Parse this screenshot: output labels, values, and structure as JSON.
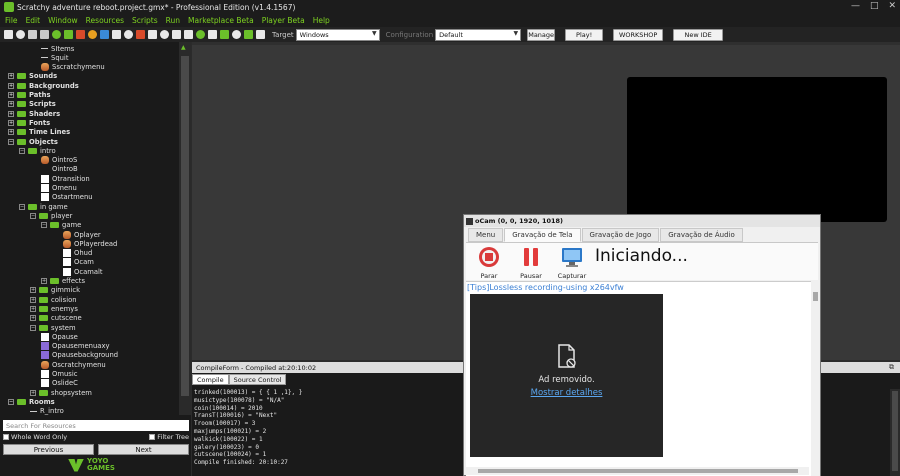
{
  "window": {
    "title": "Scratchy adventure reboot.project.gmx* - Professional Edition (v1.4.1567)",
    "controls": [
      "—",
      "□",
      "✕"
    ]
  },
  "menu": [
    "File",
    "Edit",
    "Window",
    "Resources",
    "Scripts",
    "Run",
    "Marketplace Beta",
    "Player Beta",
    "Help"
  ],
  "toolbar": {
    "icons": [
      {
        "name": "new-icon",
        "color": "#e8e8e8"
      },
      {
        "name": "open-icon",
        "color": "#e8e8e8"
      },
      {
        "name": "save-icon",
        "color": "#d0d0d0"
      },
      {
        "name": "export-icon",
        "color": "#c8c8c8"
      },
      {
        "name": "publish-icon",
        "color": "#6bbf2a"
      },
      {
        "name": "run-icon",
        "color": "#6bbf2a"
      },
      {
        "name": "debug-icon",
        "color": "#d84a2a"
      },
      {
        "name": "stop-icon",
        "color": "#e8a020"
      },
      {
        "name": "compile-icon",
        "color": "#3a8ad8"
      },
      {
        "name": "clean-icon",
        "color": "#e8e8e8"
      },
      {
        "name": "globe-icon",
        "color": "#e8e8e8"
      },
      {
        "name": "sprite-icon",
        "color": "#d84a2a"
      },
      {
        "name": "sound-icon",
        "color": "#e8e8e8"
      },
      {
        "name": "background-icon",
        "color": "#e8e8e8"
      },
      {
        "name": "path-icon",
        "color": "#e8e8e8"
      },
      {
        "name": "script-icon",
        "color": "#e8e8e8"
      },
      {
        "name": "font-icon",
        "color": "#6bbf2a"
      },
      {
        "name": "timeline-icon",
        "color": "#e8e8e8"
      },
      {
        "name": "object-icon",
        "color": "#6bbf2a"
      },
      {
        "name": "room-icon",
        "color": "#e8e8e8"
      },
      {
        "name": "settings-icon",
        "color": "#6bbf2a"
      },
      {
        "name": "extension-icon",
        "color": "#e8e8e8"
      }
    ],
    "target_label": "Target",
    "target_value": "Windows",
    "config_label": "Configuration",
    "config_value": "Default",
    "manage": "Manage",
    "play": "Play!",
    "workshop": "WORKSHOP",
    "new_ide": "New IDE"
  },
  "tree": {
    "items": [
      {
        "text": "SItems",
        "kind": "leaf-dash",
        "indent": 3
      },
      {
        "text": "Squit",
        "kind": "leaf-dash",
        "indent": 3
      },
      {
        "text": "Sscratchymenu",
        "kind": "sprite",
        "indent": 3
      },
      {
        "text": "Sounds",
        "kind": "group",
        "indent": 0
      },
      {
        "text": "Backgrounds",
        "kind": "group",
        "indent": 0
      },
      {
        "text": "Paths",
        "kind": "group",
        "indent": 0
      },
      {
        "text": "Scripts",
        "kind": "group",
        "indent": 0
      },
      {
        "text": "Shaders",
        "kind": "group",
        "indent": 0
      },
      {
        "text": "Fonts",
        "kind": "group",
        "indent": 0
      },
      {
        "text": "Time Lines",
        "kind": "group",
        "indent": 0
      },
      {
        "text": "Objects",
        "kind": "group-open",
        "indent": 0
      },
      {
        "text": "intro",
        "kind": "folder-open",
        "indent": 1
      },
      {
        "text": "OintroS",
        "kind": "sprite",
        "indent": 3
      },
      {
        "text": "OintroB",
        "kind": "blank",
        "indent": 3
      },
      {
        "text": "Otransition",
        "kind": "white",
        "indent": 3
      },
      {
        "text": "Omenu",
        "kind": "white",
        "indent": 3
      },
      {
        "text": "Ostartmenu",
        "kind": "white",
        "indent": 3
      },
      {
        "text": "in game",
        "kind": "folder-open",
        "indent": 1
      },
      {
        "text": "player",
        "kind": "folder-open",
        "indent": 2
      },
      {
        "text": "game",
        "kind": "folder-open",
        "indent": 3
      },
      {
        "text": "Oplayer",
        "kind": "sprite",
        "indent": 5
      },
      {
        "text": "OPlayerdead",
        "kind": "sprite",
        "indent": 5
      },
      {
        "text": "Ohud",
        "kind": "white",
        "indent": 5
      },
      {
        "text": "Ocam",
        "kind": "white",
        "indent": 5
      },
      {
        "text": "Ocamalt",
        "kind": "white",
        "indent": 5
      },
      {
        "text": "effects",
        "kind": "folder",
        "indent": 3
      },
      {
        "text": "gimmick",
        "kind": "folder",
        "indent": 2
      },
      {
        "text": "colision",
        "kind": "folder",
        "indent": 2
      },
      {
        "text": "enemys",
        "kind": "folder",
        "indent": 2
      },
      {
        "text": "cutscene",
        "kind": "folder",
        "indent": 2
      },
      {
        "text": "system",
        "kind": "folder-open",
        "indent": 2
      },
      {
        "text": "Opause",
        "kind": "white",
        "indent": 3
      },
      {
        "text": "Opausemenuaxy",
        "kind": "purple",
        "indent": 3
      },
      {
        "text": "Opausebackground",
        "kind": "purple",
        "indent": 3
      },
      {
        "text": "Oscratchymenu",
        "kind": "sprite",
        "indent": 3
      },
      {
        "text": "Omusic",
        "kind": "white",
        "indent": 3
      },
      {
        "text": "OslideC",
        "kind": "white",
        "indent": 3
      },
      {
        "text": "shopsystem",
        "kind": "folder",
        "indent": 2
      },
      {
        "text": "Rooms",
        "kind": "group-open",
        "indent": 0
      },
      {
        "text": "R_intro",
        "kind": "leaf-dash",
        "indent": 2
      }
    ],
    "search_placeholder": "Search For Resources",
    "whole_word": "Whole Word Only",
    "filter_tree": "Filter Tree",
    "previous": "Previous",
    "next": "Next"
  },
  "logo": {
    "line1": "YOYO",
    "line2": "GAMES"
  },
  "compile": {
    "header": "CompileForm - Compiled at:20:10:02",
    "tabs": [
      "Compile",
      "Source Control"
    ],
    "log": [
      "trinked(100013) = { { 1 ,1},  }",
      "musictype(100078) = \"N/A\"",
      "coin(100014) = 2010",
      "TransT(100016) = \"Next\"",
      "Troom(100017) = 3",
      "maxjumps(100021) = 2",
      "walkick(100022) = 1",
      "galery(100023) = 0",
      "cutscene(100024) = 1",
      "Compile finished: 20:10:27"
    ]
  },
  "ocam": {
    "title": "oCam (0, 0, 1920, 1018)",
    "tabs": [
      "Menu",
      "Gravação de Tela",
      "Gravação de Jogo",
      "Gravação de Áudio"
    ],
    "active_tab": 1,
    "tools": [
      {
        "label": "Parar",
        "icon": "stop-record-icon"
      },
      {
        "label": "Pausar",
        "icon": "pause-icon"
      },
      {
        "label": "Capturar",
        "icon": "capture-monitor-icon"
      }
    ],
    "status": "Iniciando...",
    "tips": "[Tips]Lossless recording-using x264vfw",
    "ad_label": "Ad removido.",
    "ad_link": "Mostrar detalhes"
  }
}
